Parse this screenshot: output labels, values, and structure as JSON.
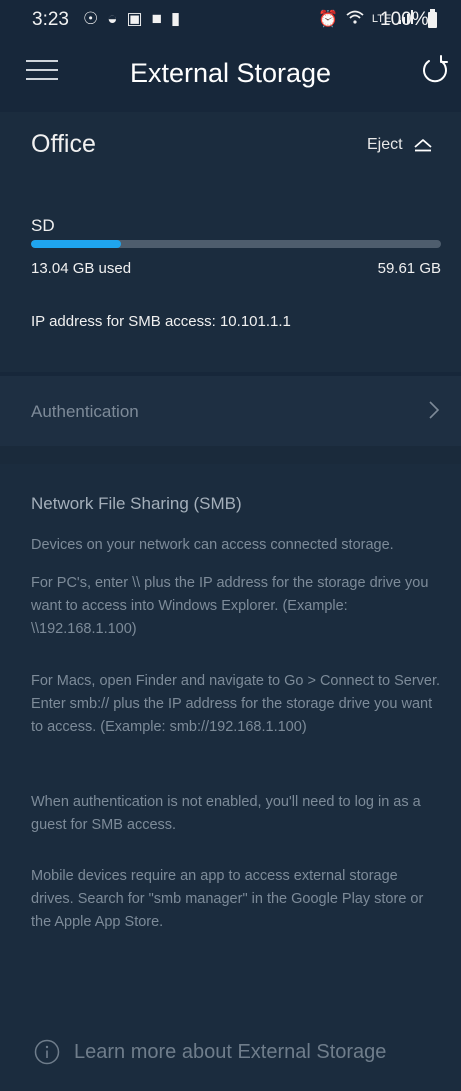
{
  "status_bar": {
    "time": "3:23",
    "left_icons": [
      "notification-icon",
      "messenger-icon",
      "gallery-icon",
      "chat-icon",
      "battery-saver-icon"
    ],
    "right_icons": [
      "alarm-icon",
      "wifi-icon",
      "lte-icon",
      "signal-icon"
    ],
    "battery_percent": "100%"
  },
  "header": {
    "title": "External Storage"
  },
  "drive": {
    "name": "Office",
    "eject_label": "Eject",
    "storage_type": "SD",
    "used_label": "13.04 GB used",
    "total_label": "59.61 GB",
    "used_fraction": 0.219,
    "ip_line": "IP address for SMB access: 10.101.1.1"
  },
  "authentication": {
    "label": "Authentication"
  },
  "info": {
    "heading": "Network File Sharing (SMB)",
    "paragraphs": [
      "Devices on your network can access connected storage.",
      "For PC's, enter \\\\ plus the IP address for the storage drive you want to access into Windows Explorer. (Example: \\\\192.168.1.100)",
      "For Macs, open Finder and navigate to Go > Connect to Server. Enter smb:// plus the IP address for the storage drive you want to access. (Example: smb://192.168.1.100)",
      "When authentication is not enabled, you'll need to log in as a guest for SMB access.",
      "Mobile devices require an app to access external storage drives. Search for \"smb manager\" in the Google Play store or the Apple App Store."
    ],
    "learn_more": "Learn more about External Storage"
  },
  "colors": {
    "background": "#1a2a3b",
    "accent": "#1fa5ef",
    "muted_text": "#7d8b99"
  }
}
